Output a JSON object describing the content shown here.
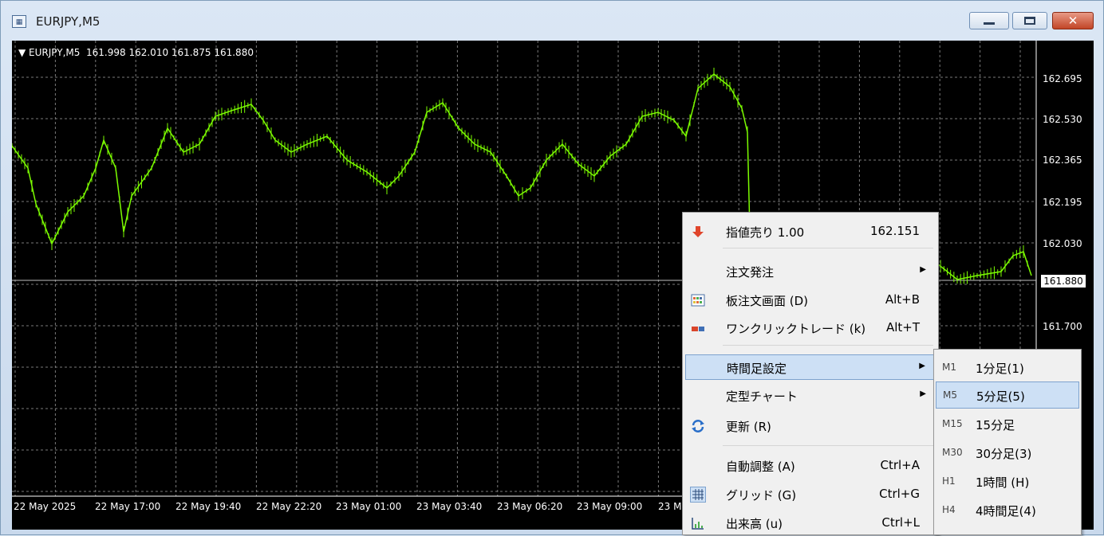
{
  "window": {
    "title": "EURJPY,M5",
    "icon": "chart-window-icon"
  },
  "chart": {
    "info_line": "EURJPY,M5  161.998 162.010 161.875 161.880",
    "price_ticks": [
      "162.695",
      "162.530",
      "162.365",
      "162.195",
      "162.030",
      "161.700"
    ],
    "current_price": "161.880",
    "time_ticks": [
      "22 May 2025",
      "22 May 17:00",
      "22 May 19:40",
      "22 May 22:20",
      "23 May 01:00",
      "23 May 03:40",
      "23 May 06:20",
      "23 May 09:00",
      "23 M"
    ],
    "colors": {
      "background": "#000000",
      "candles": "#7CFC00",
      "grid": "#7a7a7a"
    }
  },
  "context_menu": {
    "items": [
      {
        "label": "指値売り 1.00",
        "shortcut": "162.151",
        "icon": "sell-limit-icon"
      },
      {
        "label": "注文発注",
        "submenu": true
      },
      {
        "label": "板注文画面 (D)",
        "shortcut": "Alt+B",
        "icon": "order-board-icon"
      },
      {
        "label": "ワンクリックトレード (k)",
        "shortcut": "Alt+T",
        "icon": "one-click-trade-icon"
      },
      {
        "label": "時間足設定",
        "submenu": true,
        "highlighted": true
      },
      {
        "label": "定型チャート",
        "submenu": true
      },
      {
        "label": "更新 (R)",
        "icon": "refresh-icon"
      },
      {
        "label": "自動調整 (A)",
        "shortcut": "Ctrl+A"
      },
      {
        "label": "グリッド (G)",
        "shortcut": "Ctrl+G",
        "icon": "grid-icon"
      },
      {
        "label": "出来高 (u)",
        "shortcut": "Ctrl+L",
        "icon": "volume-icon"
      }
    ]
  },
  "timeframe_submenu": {
    "items": [
      {
        "code": "M1",
        "label": "1分足(1)"
      },
      {
        "code": "M5",
        "label": "5分足(5)",
        "highlighted": true
      },
      {
        "code": "M15",
        "label": "15分足"
      },
      {
        "code": "M30",
        "label": "30分足(3)"
      },
      {
        "code": "H1",
        "label": "1時間 (H)"
      },
      {
        "code": "H4",
        "label": "4時間足(4)"
      }
    ]
  }
}
